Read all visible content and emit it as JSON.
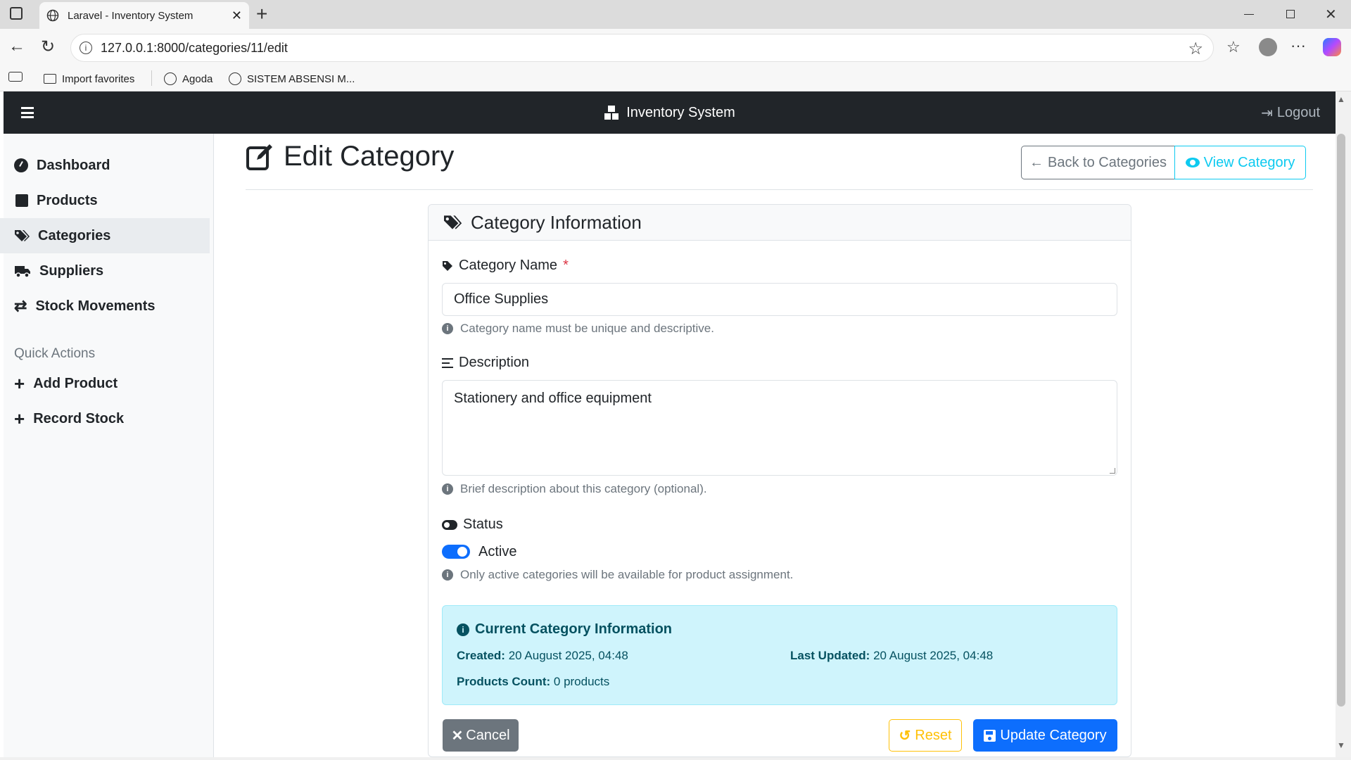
{
  "browser": {
    "tab_title": "Laravel - Inventory System",
    "url": "127.0.0.1:8000/categories/11/edit",
    "favorites": [
      "Import favorites",
      "Agoda",
      "SISTEM ABSENSI M..."
    ]
  },
  "navbar": {
    "brand": "Inventory System",
    "logout": "Logout"
  },
  "sidebar": {
    "items": [
      {
        "label": "Dashboard",
        "icon": "dashboard-icon"
      },
      {
        "label": "Products",
        "icon": "box-icon"
      },
      {
        "label": "Categories",
        "icon": "tags-icon",
        "active": true
      },
      {
        "label": "Suppliers",
        "icon": "truck-icon"
      },
      {
        "label": "Stock Movements",
        "icon": "exchange-icon"
      }
    ],
    "quick_actions_heading": "Quick Actions",
    "quick_actions": [
      {
        "label": "Add Product",
        "icon": "plus-icon"
      },
      {
        "label": "Record Stock",
        "icon": "plus-icon"
      }
    ]
  },
  "page": {
    "title": "Edit Category",
    "back_button": "Back to Categories",
    "view_button": "View Category"
  },
  "card": {
    "header": "Category Information",
    "name_label": "Category Name",
    "required_mark": "*",
    "name_value": "Office Supplies",
    "name_help": "Category name must be unique and descriptive.",
    "description_label": "Description",
    "description_value": "Stationery and office equipment",
    "description_help": "Brief description about this category (optional).",
    "status_label": "Status",
    "status_value": "Active",
    "status_on": true,
    "status_help": "Only active categories will be available for product assignment."
  },
  "info": {
    "heading": "Current Category Information",
    "created_label": "Created:",
    "created_value": "20 August 2025, 04:48",
    "updated_label": "Last Updated:",
    "updated_value": "20 August 2025, 04:48",
    "count_label": "Products Count:",
    "count_value": "0 products"
  },
  "actions": {
    "cancel": "Cancel",
    "reset": "Reset",
    "update": "Update Category"
  },
  "colors": {
    "primary": "#0d6efd",
    "info": "#0dcaf0",
    "warning": "#ffc107",
    "secondary": "#6c757d",
    "navbar": "#212529"
  }
}
